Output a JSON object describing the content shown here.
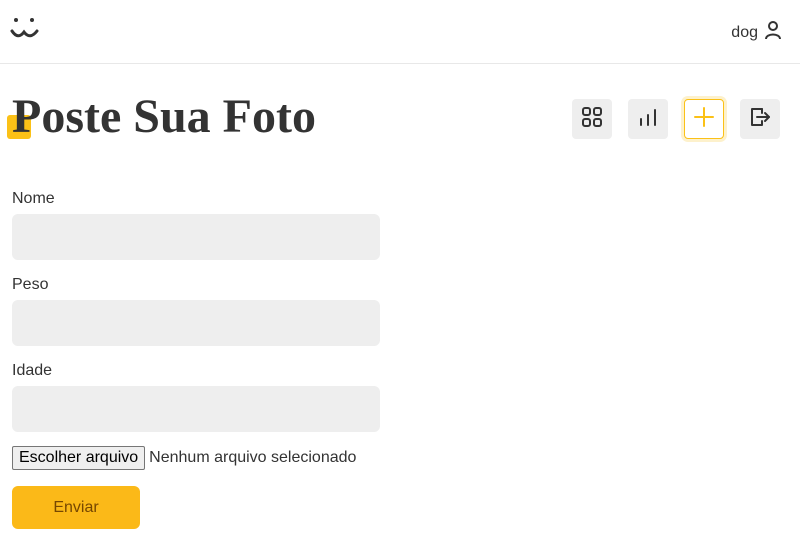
{
  "header": {
    "logo_icon": "dog-face-logo-icon",
    "username": "dog",
    "user_icon": "user-icon"
  },
  "page": {
    "title": "Poste Sua Foto"
  },
  "nav": {
    "items": [
      {
        "icon": "grid-icon",
        "active": false
      },
      {
        "icon": "bar-chart-icon",
        "active": false
      },
      {
        "icon": "plus-icon",
        "active": true
      },
      {
        "icon": "logout-icon",
        "active": false
      }
    ]
  },
  "form": {
    "name_label": "Nome",
    "name_value": "",
    "weight_label": "Peso",
    "weight_value": "",
    "age_label": "Idade",
    "age_value": "",
    "file_button_label": "Escolher arquivo",
    "file_status": "Nenhum arquivo selecionado",
    "submit_label": "Enviar"
  },
  "colors": {
    "accent": "#fbc117",
    "input_bg": "#eeeeee",
    "submit_text": "#764701"
  }
}
